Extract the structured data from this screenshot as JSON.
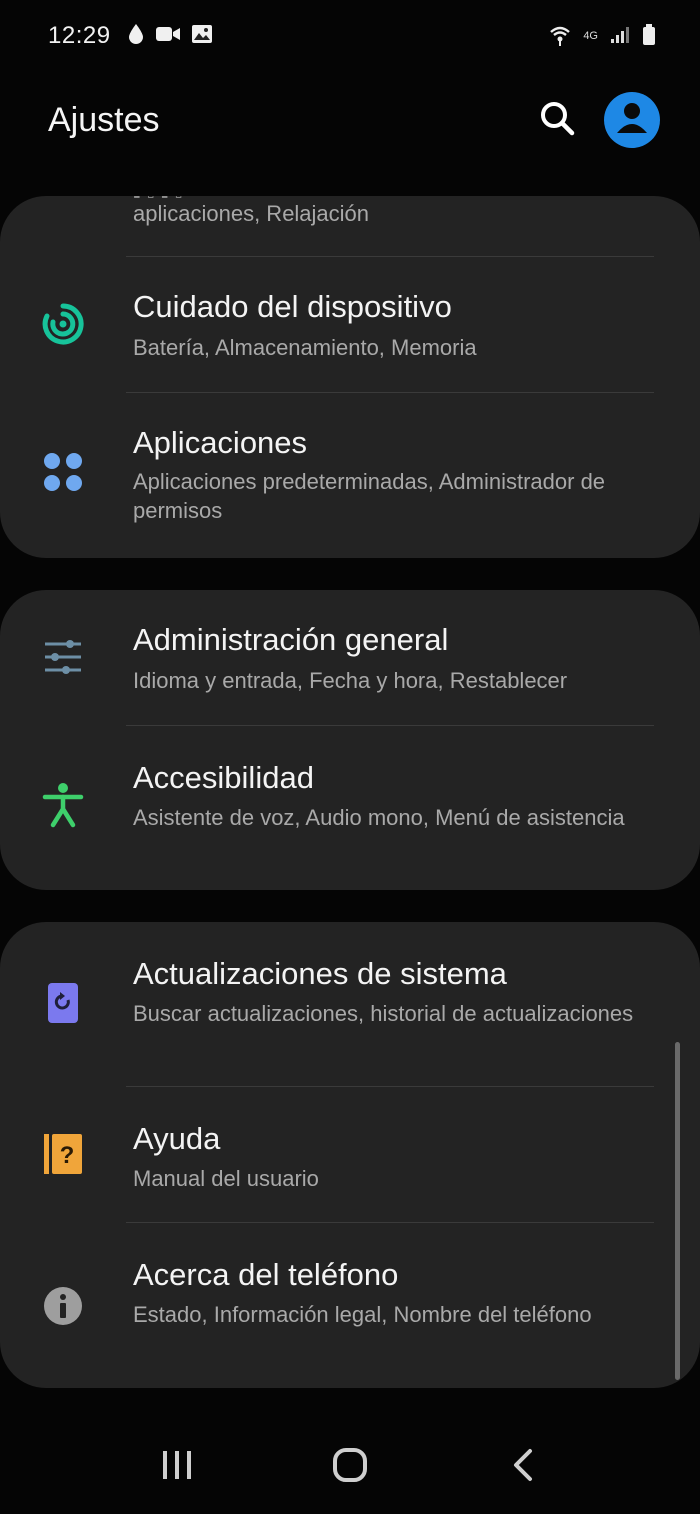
{
  "status_bar": {
    "time": "12:29",
    "left_icons": [
      "drop-icon",
      "video-camera-icon",
      "image-icon"
    ],
    "right_icons": [
      "wifi-icon",
      "signal-icon",
      "battery-icon"
    ],
    "network_label": "4G"
  },
  "header": {
    "title": "Ajustes",
    "search_icon": "search-icon",
    "account_icon": "account-icon"
  },
  "colors": {
    "background": "#050505",
    "card": "#232323",
    "accent_blue": "#1e88e5",
    "device_care": "#17c39a",
    "apps": "#6fa8ef",
    "general": "#6d8fa6",
    "accessibility": "#3ecf6b",
    "updates": "#7b79ee",
    "help": "#f0a53a",
    "about": "#9e9e9e"
  },
  "settings": {
    "partial_item": {
      "subtitle": "aplicaciones, Relajación"
    },
    "items": [
      {
        "title": "Cuidado del dispositivo",
        "subtitle": "Batería, Almacenamiento, Memoria",
        "icon": "device-care-icon"
      },
      {
        "title": "Aplicaciones",
        "subtitle": "Aplicaciones predeterminadas, Administrador de permisos",
        "icon": "apps-icon"
      },
      {
        "title": "Administración general",
        "subtitle": "Idioma y entrada, Fecha y hora, Restablecer",
        "icon": "sliders-icon"
      },
      {
        "title": "Accesibilidad",
        "subtitle": "Asistente de voz, Audio mono, Menú de asistencia",
        "icon": "accessibility-icon"
      },
      {
        "title": "Actualizaciones de sistema",
        "subtitle": "Buscar actualizaciones, historial de actualizaciones",
        "icon": "software-update-icon"
      },
      {
        "title": "Ayuda",
        "subtitle": "Manual del usuario",
        "icon": "help-book-icon"
      },
      {
        "title": "Acerca del teléfono",
        "subtitle": "Estado, Información legal, Nombre del teléfono",
        "icon": "info-icon"
      }
    ]
  },
  "nav_bar": {
    "recents_icon": "recents-icon",
    "home_icon": "home-icon",
    "back_icon": "back-icon"
  }
}
